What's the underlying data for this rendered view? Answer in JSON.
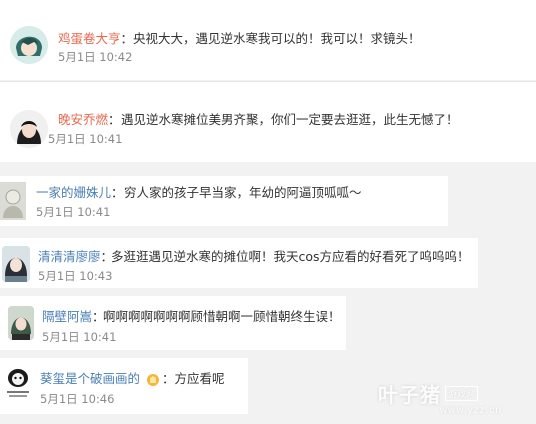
{
  "comments": [
    {
      "username": "鸡蛋卷大亨",
      "colon": "：",
      "text": "央视大大，遇见逆水寒我可以的！我可以！求镜头！",
      "time": "5月1日 10:42",
      "avatar_icon": "teal-haired-anime-avatar-icon"
    },
    {
      "username": "晚安乔燃",
      "colon": "：",
      "text": "遇见逆水寒摊位美男齐聚，你们一定要去逛逛，此生无憾了！",
      "time": "5月1日 10:41",
      "avatar_icon": "dark-haired-portrait-avatar-icon"
    },
    {
      "username": "一家的姗姝儿",
      "colon": "：",
      "text": "穷人家的孩子早当家，年幼的阿逼顶呱呱～",
      "time": "5月1日 10:41",
      "avatar_icon": "sketch-avatar-icon"
    },
    {
      "username": "清清清廖廖",
      "colon": "：",
      "text": "多逛逛遇见逆水寒的摊位啊！我天cos方应看的好看死了呜呜呜！",
      "time": "5月1日 10:43",
      "avatar_icon": "anime-character-avatar-icon"
    },
    {
      "username": "隔壁阿嵩",
      "colon": "：",
      "text": "啊啊啊啊啊啊啊顾惜朝啊一顾惜朝终生误！",
      "time": "5月1日 10:41",
      "avatar_icon": "green-haired-anime-avatar-icon"
    },
    {
      "username": "葵玺是个破画画的",
      "colon": "：方应看呢",
      "text": "",
      "time": "5月1日 10:46",
      "avatar_icon": "panda-meme-avatar-icon",
      "badge_icon": "gold-badge-icon"
    }
  ],
  "watermark": {
    "brand": "叶子猪",
    "tag": "游戏网",
    "url": "www.yzz.cn"
  },
  "colors": {
    "username_orange": "#e8674c",
    "username_blue": "#4a7fb5",
    "time_gray": "#8a8a8a"
  }
}
